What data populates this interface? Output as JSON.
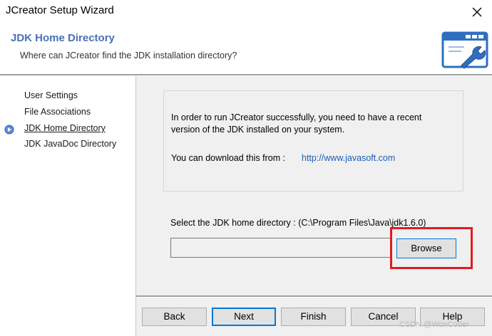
{
  "window": {
    "title": "JCreator Setup Wizard"
  },
  "header": {
    "title": "JDK Home Directory",
    "subtitle": "Where can JCreator find the JDK installation directory?",
    "icon": "window-wrench-icon"
  },
  "sidebar": {
    "items": [
      {
        "label": "User Settings",
        "active": false
      },
      {
        "label": "File Associations",
        "active": false
      },
      {
        "label": "JDK Home Directory",
        "active": true
      },
      {
        "label": "JDK JavaDoc Directory",
        "active": false
      }
    ]
  },
  "info": {
    "line1": "In order to run JCreator successfully, you need to have a recent",
    "line2": "version of the JDK installed on your system.",
    "download_label": "You can download this from :",
    "download_link": "http://www.javasoft.com"
  },
  "select": {
    "label": "Select the JDK home directory : (C:\\Program Files\\Java\\jdk1.6.0)",
    "path_value": "",
    "browse_label": "Browse"
  },
  "buttons": {
    "back": "Back",
    "next": "Next",
    "finish": "Finish",
    "cancel": "Cancel",
    "help": "Help"
  },
  "watermark": "CSDN @WonCoder",
  "colors": {
    "header_title": "#4a6fb5",
    "link": "#1a5fb4",
    "highlight_box": "#e01b24",
    "focus_border": "#0078d7"
  }
}
